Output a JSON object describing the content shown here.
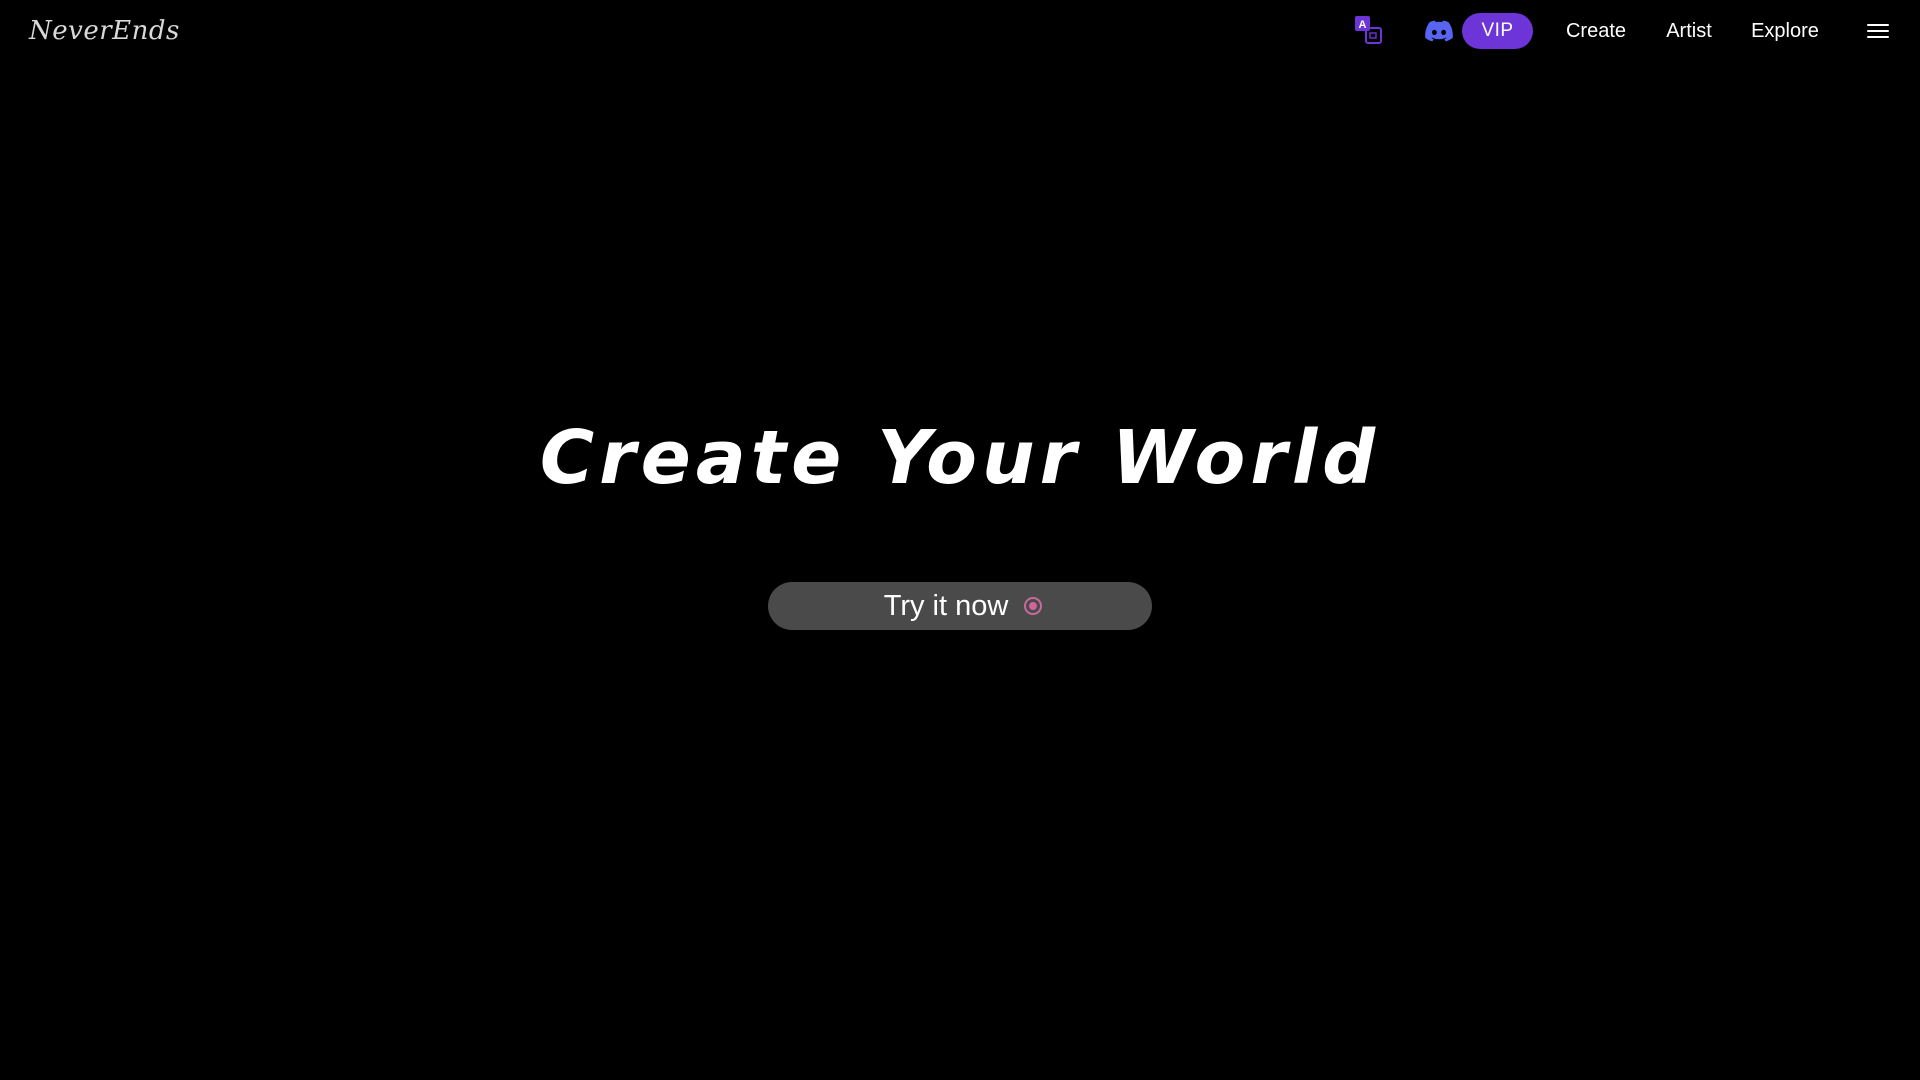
{
  "header": {
    "logo_text": "NeverEnds",
    "icons": {
      "translate": "translate-icon",
      "discord": "discord-icon",
      "menu": "hamburger-menu-icon"
    },
    "vip_label": "VIP",
    "nav_links": {
      "create": "Create",
      "artist": "Artist",
      "explore": "Explore"
    }
  },
  "hero": {
    "title": "Create Your World",
    "cta_label": "Try it now",
    "cta_icon": "record-dot-icon"
  },
  "colors": {
    "background": "#000000",
    "accent": "#6d35d8",
    "discord": "#5865f2",
    "cta_background": "#4a4a4a",
    "cta_dot": "#d0649c"
  }
}
